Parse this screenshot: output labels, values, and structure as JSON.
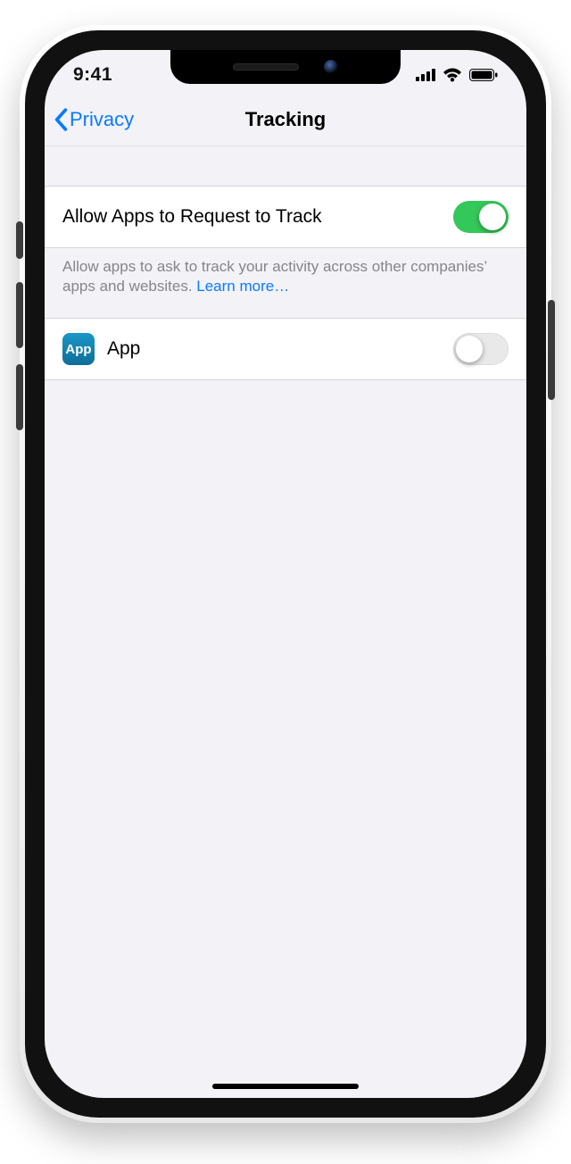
{
  "status": {
    "time": "9:41"
  },
  "nav": {
    "back_label": "Privacy",
    "title": "Tracking"
  },
  "main": {
    "allow_row": {
      "title": "Allow Apps to Request to Track",
      "on": true
    },
    "footer_text": "Allow apps to ask to track your activity across other companies’ apps and websites. ",
    "footer_link": "Learn more…"
  },
  "apps": [
    {
      "name": "App",
      "icon_label": "App",
      "on": false
    }
  ]
}
